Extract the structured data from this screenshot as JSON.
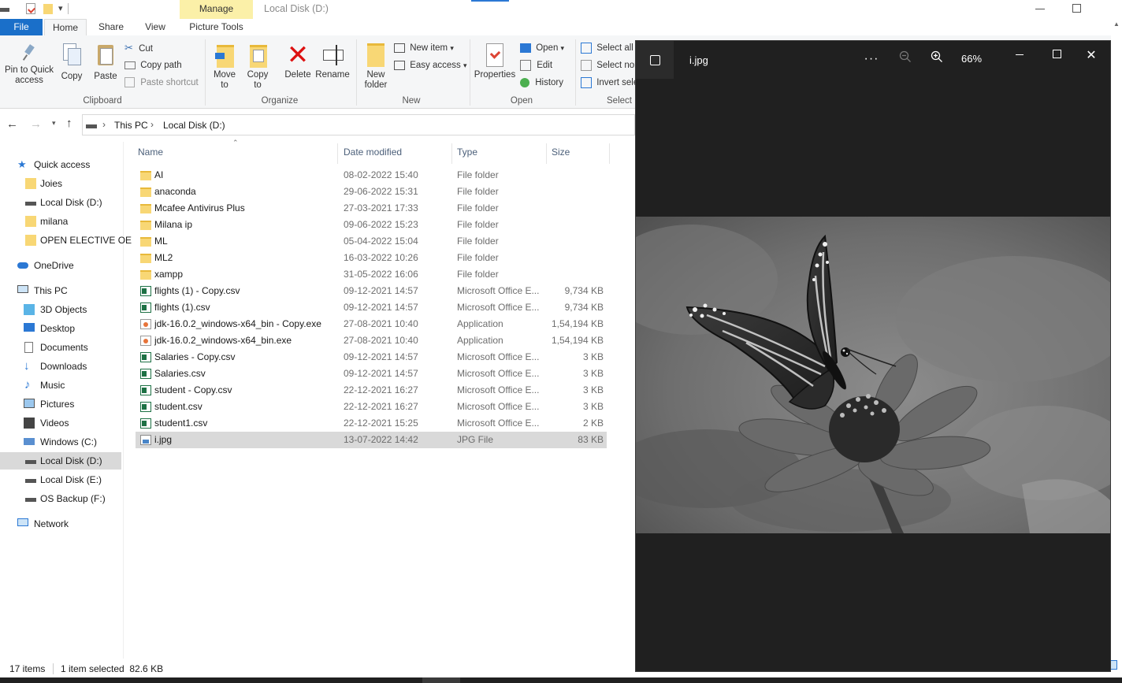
{
  "window": {
    "context_tab": "Manage",
    "title": "Local Disk (D:)"
  },
  "tabs": {
    "file": "File",
    "home": "Home",
    "share": "Share",
    "view": "View",
    "picture_tools": "Picture Tools"
  },
  "ribbon": {
    "pin": "Pin to Quick access",
    "copy": "Copy",
    "paste": "Paste",
    "cut": "Cut",
    "copy_path": "Copy path",
    "paste_shortcut": "Paste shortcut",
    "clipboard": "Clipboard",
    "move_to": "Move to",
    "copy_to": "Copy to",
    "delete": "Delete",
    "rename": "Rename",
    "organize": "Organize",
    "new_folder": "New folder",
    "new_item": "New item",
    "easy_access": "Easy access",
    "new": "New",
    "properties": "Properties",
    "open": "Open",
    "edit": "Edit",
    "history": "History",
    "open_group": "Open",
    "select_all": "Select all",
    "select_none": "Select nor",
    "invert_selection": "Invert sele",
    "select": "Select"
  },
  "address": {
    "crumb1": "This PC",
    "crumb2": "Local Disk (D:)"
  },
  "nav": {
    "quick_access": "Quick access",
    "joies": "Joies",
    "local_d_pinned": "Local Disk (D:)",
    "milana": "milana",
    "open_elective": "OPEN ELECTIVE OE",
    "onedrive": "OneDrive",
    "this_pc": "This PC",
    "objects3d": "3D Objects",
    "desktop": "Desktop",
    "documents": "Documents",
    "downloads": "Downloads",
    "music": "Music",
    "pictures": "Pictures",
    "videos": "Videos",
    "windows_c": "Windows (C:)",
    "local_d": "Local Disk (D:)",
    "local_e": "Local Disk (E:)",
    "os_backup": "OS Backup (F:)",
    "network": "Network"
  },
  "columns": {
    "name": "Name",
    "date": "Date modified",
    "type": "Type",
    "size": "Size"
  },
  "files": [
    {
      "name": "AI",
      "date": "08-02-2022 15:40",
      "type": "File folder",
      "size": "",
      "icon": "folder-icon"
    },
    {
      "name": "anaconda",
      "date": "29-06-2022 15:31",
      "type": "File folder",
      "size": "",
      "icon": "folder-icon"
    },
    {
      "name": "Mcafee Antivirus Plus",
      "date": "27-03-2021 17:33",
      "type": "File folder",
      "size": "",
      "icon": "folder-icon"
    },
    {
      "name": "Milana ip",
      "date": "09-06-2022 15:23",
      "type": "File folder",
      "size": "",
      "icon": "folder-icon"
    },
    {
      "name": "ML",
      "date": "05-04-2022 15:04",
      "type": "File folder",
      "size": "",
      "icon": "folder-icon"
    },
    {
      "name": "ML2",
      "date": "16-03-2022 10:26",
      "type": "File folder",
      "size": "",
      "icon": "folder-icon"
    },
    {
      "name": "xampp",
      "date": "31-05-2022 16:06",
      "type": "File folder",
      "size": "",
      "icon": "folder-icon"
    },
    {
      "name": "flights (1) - Copy.csv",
      "date": "09-12-2021 14:57",
      "type": "Microsoft Office E...",
      "size": "9,734 KB",
      "icon": "excel-csv-icon"
    },
    {
      "name": "flights (1).csv",
      "date": "09-12-2021 14:57",
      "type": "Microsoft Office E...",
      "size": "9,734 KB",
      "icon": "excel-csv-icon"
    },
    {
      "name": "jdk-16.0.2_windows-x64_bin - Copy.exe",
      "date": "27-08-2021 10:40",
      "type": "Application",
      "size": "1,54,194 KB",
      "icon": "installer-icon"
    },
    {
      "name": "jdk-16.0.2_windows-x64_bin.exe",
      "date": "27-08-2021 10:40",
      "type": "Application",
      "size": "1,54,194 KB",
      "icon": "installer-icon"
    },
    {
      "name": "Salaries - Copy.csv",
      "date": "09-12-2021 14:57",
      "type": "Microsoft Office E...",
      "size": "3 KB",
      "icon": "excel-csv-icon"
    },
    {
      "name": "Salaries.csv",
      "date": "09-12-2021 14:57",
      "type": "Microsoft Office E...",
      "size": "3 KB",
      "icon": "excel-csv-icon"
    },
    {
      "name": "student - Copy.csv",
      "date": "22-12-2021 16:27",
      "type": "Microsoft Office E...",
      "size": "3 KB",
      "icon": "excel-csv-icon"
    },
    {
      "name": "student.csv",
      "date": "22-12-2021 16:27",
      "type": "Microsoft Office E...",
      "size": "3 KB",
      "icon": "excel-csv-icon"
    },
    {
      "name": "student1.csv",
      "date": "22-12-2021 15:25",
      "type": "Microsoft Office E...",
      "size": "2 KB",
      "icon": "excel-csv-icon"
    },
    {
      "name": "i.jpg",
      "date": "13-07-2022 14:42",
      "type": "JPG File",
      "size": "83 KB",
      "icon": "jpg-file-icon",
      "selected": true
    }
  ],
  "status": {
    "count": "17 items",
    "selection": "1 item selected  82.6 KB"
  },
  "viewer": {
    "filename": "i.jpg",
    "zoom": "66%",
    "more": "···"
  }
}
